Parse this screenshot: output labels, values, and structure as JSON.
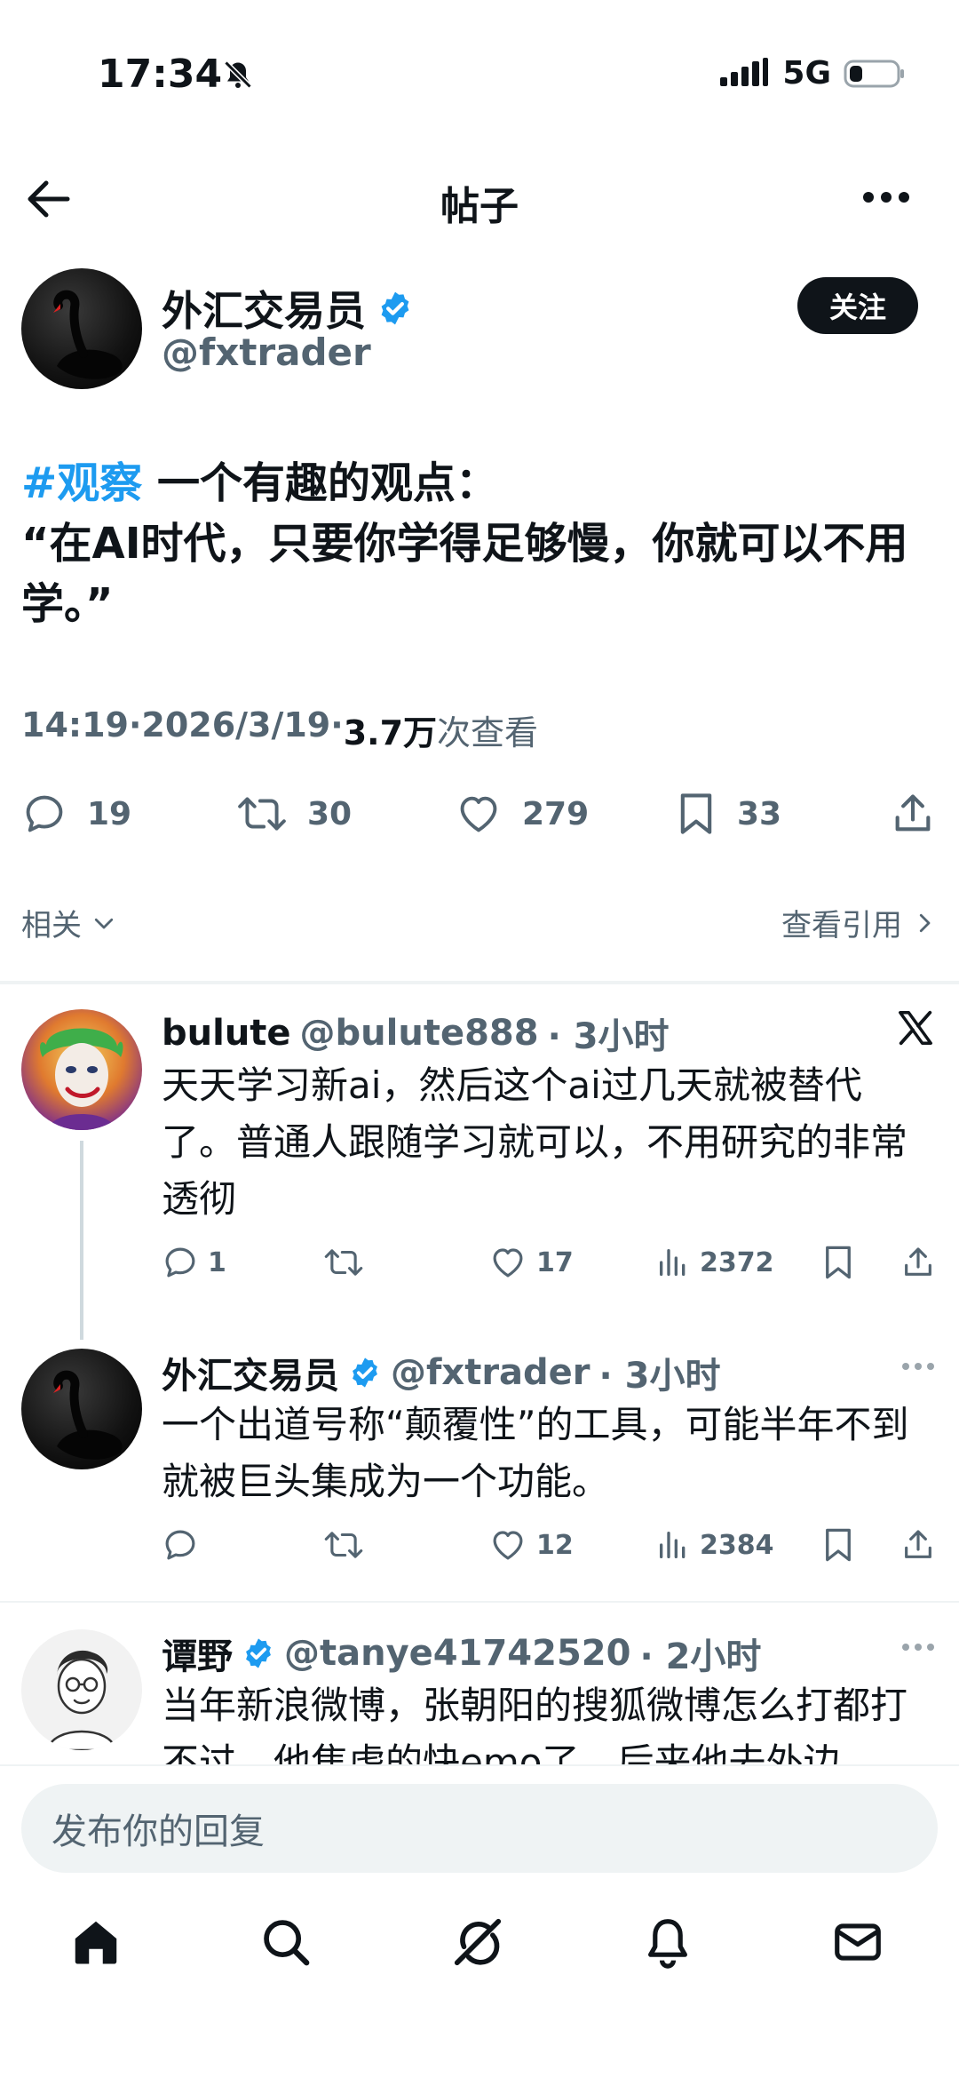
{
  "status_bar": {
    "time": "17:34",
    "network": "5G"
  },
  "nav": {
    "title": "帖子"
  },
  "post": {
    "author_name": "外汇交易员",
    "handle": "@fxtrader",
    "follow_label": "关注",
    "hashtag": "#观察",
    "text_line1_rest": " 一个有趣的观点：",
    "text_line2": "“在AI时代，只要你学得足够慢，你就可以不用学。”",
    "time": "14:19",
    "date": "2026/3/19",
    "views_count": "3.7万",
    "views_label": " 次查看",
    "sep": " · ",
    "replies": "19",
    "retweets": "30",
    "likes": "279",
    "bookmarks": "33"
  },
  "related": {
    "label": "相关",
    "quotes_label": "查看引用"
  },
  "replies": [
    {
      "name": "bulute",
      "handle": "@bulute888",
      "time": "· 3小时",
      "text": "天天学习新ai，然后这个ai过几天就被替代了。普通人跟随学习就可以，不用研究的非常透彻",
      "replies": "1",
      "retweets": "",
      "likes": "17",
      "views": "2372"
    },
    {
      "name": "外汇交易员",
      "handle": "@fxtrader",
      "time": "· 3小时",
      "text": "一个出道号称“颠覆性”的工具，可能半年不到就被巨头集成为一个功能。",
      "replies": "",
      "retweets": "",
      "likes": "12",
      "views": "2384"
    },
    {
      "name": "谭野",
      "handle": "@tanye41742520",
      "time": "· 2小时",
      "text": "当年新浪微博，张朝阳的搜狐微博怎么打都打不过，他焦虑的快emo了，后来他去外边"
    }
  ],
  "composer": {
    "placeholder": "发布你的回复"
  },
  "tabs": [
    "home-icon",
    "search-icon",
    "grok-icon",
    "notifications-icon",
    "messages-icon"
  ],
  "colors": {
    "accent": "#1d9bf0",
    "text": "#0f1419",
    "muted": "#536471",
    "verified": "#1d9bf0"
  }
}
